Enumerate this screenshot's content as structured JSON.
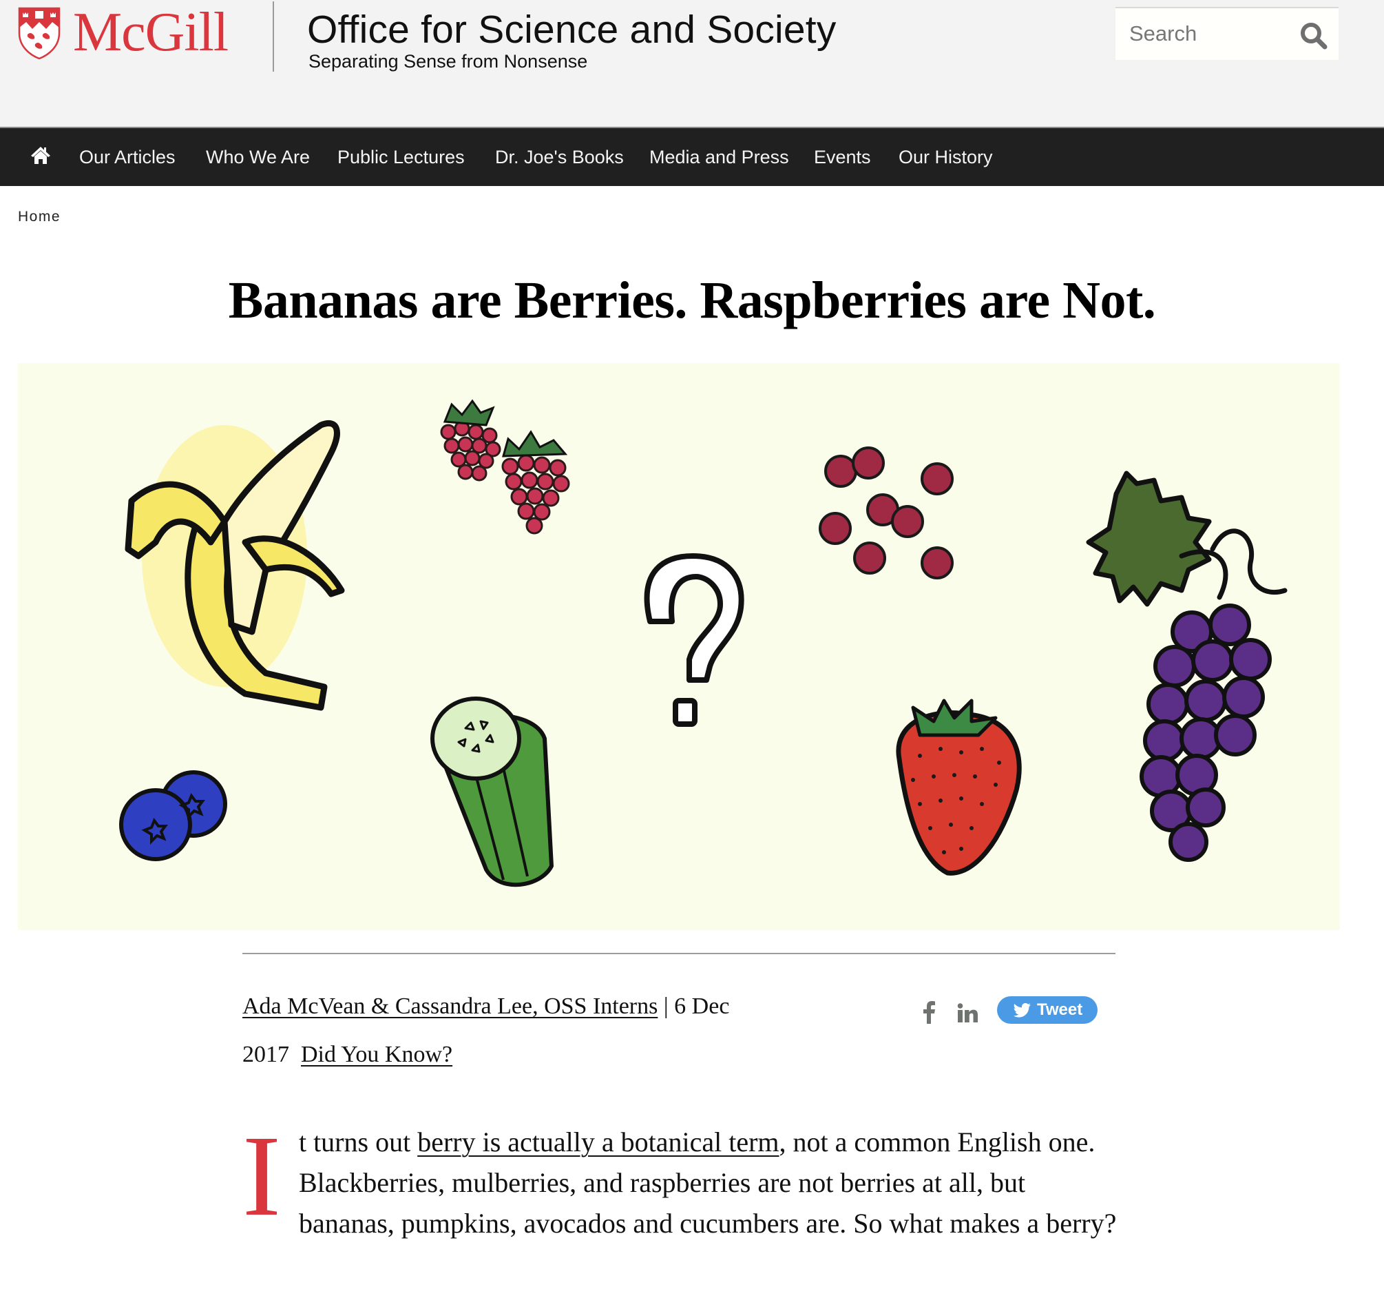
{
  "header": {
    "logo_wordmark": "McGill",
    "site_title": "Office for Science and Society",
    "site_tagline": "Separating Sense from Nonsense",
    "search": {
      "placeholder": "Search",
      "value": ""
    },
    "brand_color": "#d9363e"
  },
  "nav": {
    "home_icon": "home-icon",
    "items": [
      {
        "label": "Our Articles"
      },
      {
        "label": "Who We Are"
      },
      {
        "label": "Public Lectures"
      },
      {
        "label": "Dr. Joe's Books"
      },
      {
        "label": "Media and Press"
      },
      {
        "label": "Events"
      },
      {
        "label": "Our History"
      }
    ]
  },
  "breadcrumb": {
    "items": [
      {
        "label": "Home"
      }
    ]
  },
  "article": {
    "title": "Bananas are Berries. Raspberries are Not.",
    "hero": {
      "background": "#fbfdeb",
      "illustrations": [
        "banana",
        "raspberries",
        "cranberries",
        "grapes",
        "question-mark",
        "blueberries",
        "cucumber",
        "strawberry"
      ]
    },
    "byline": {
      "authors": "Ada McVean & Cassandra Lee, OSS Interns",
      "separator": "|",
      "date_part1": "6 Dec",
      "date_part2": "2017",
      "category": "Did You Know?"
    },
    "share": {
      "facebook_icon": "facebook-icon",
      "linkedin_icon": "linkedin-icon",
      "tweet_label": "Tweet",
      "tweet_color": "#4a9ae6"
    },
    "body": {
      "drop_cap": "I",
      "text_before_link": "t turns out ",
      "link_text": "berry is actually a botanical term",
      "text_after_link": ", not a common English one. Blackberries, mulberries, and raspberries are not berries at all, but bananas, pumpkins, avocados and cucumbers are. So what makes a berry?"
    }
  }
}
